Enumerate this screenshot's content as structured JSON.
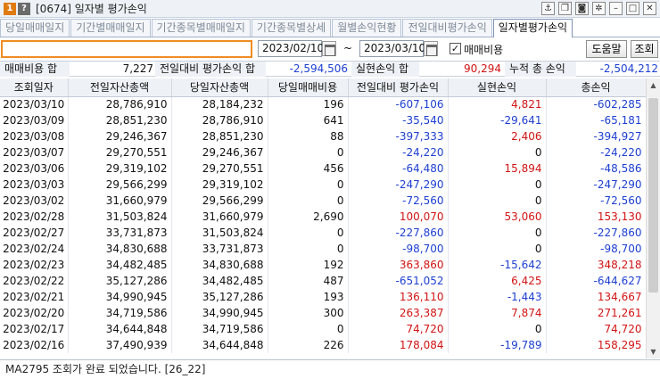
{
  "window": {
    "badge_number": "1",
    "badge_help": "?",
    "title": "[0674] 일자별 평가손익",
    "icons": [
      "link-icon",
      "copy-icon",
      "camera-icon",
      "gear-icon",
      "minimize-icon",
      "maximize-icon",
      "close-icon"
    ]
  },
  "tabs": [
    {
      "label": "당일매매일지"
    },
    {
      "label": "기간별매매일지"
    },
    {
      "label": "기간종목별매매일지"
    },
    {
      "label": "기간종목별상세"
    },
    {
      "label": "월별손익현황"
    },
    {
      "label": "전일대비평가손익"
    },
    {
      "label": "일자별평가손익"
    }
  ],
  "active_tab_index": 6,
  "toolbar": {
    "account_value": "",
    "start_date": "2023/02/10",
    "tilde": "~",
    "end_date": "2023/03/10",
    "fee_checkbox_checked": true,
    "fee_checkbox_label": "매매비용",
    "help_button": "도움말",
    "search_button": "조회"
  },
  "summary": {
    "fee_label": "매매비용 합",
    "fee_value": "7,227",
    "eval_label": "전일대비 평가손익 합",
    "eval_value": "-2,594,506",
    "realized_label": "실현손익 합",
    "realized_value": "90,294",
    "total_label": "누적 총 손익",
    "total_value": "-2,504,212"
  },
  "colors": {
    "negative": "#1d3fd1",
    "positive": "#d11414",
    "accent_border": "#f08c24"
  },
  "table": {
    "columns": [
      "조회일자",
      "전일자산총액",
      "당일자산총액",
      "당일매매비용",
      "전일대비 평가손익",
      "실현손익",
      "총손익"
    ],
    "rows": [
      [
        "2023/03/10",
        "28,786,910",
        "28,184,232",
        "196",
        "-607,106",
        "4,821",
        "-602,285"
      ],
      [
        "2023/03/09",
        "28,851,230",
        "28,786,910",
        "641",
        "-35,540",
        "-29,641",
        "-65,181"
      ],
      [
        "2023/03/08",
        "29,246,367",
        "28,851,230",
        "88",
        "-397,333",
        "2,406",
        "-394,927"
      ],
      [
        "2023/03/07",
        "29,270,551",
        "29,246,367",
        "0",
        "-24,220",
        "0",
        "-24,220"
      ],
      [
        "2023/03/06",
        "29,319,102",
        "29,270,551",
        "456",
        "-64,480",
        "15,894",
        "-48,586"
      ],
      [
        "2023/03/03",
        "29,566,299",
        "29,319,102",
        "0",
        "-247,290",
        "0",
        "-247,290"
      ],
      [
        "2023/03/02",
        "31,660,979",
        "29,566,299",
        "0",
        "-72,560",
        "0",
        "-72,560"
      ],
      [
        "2023/02/28",
        "31,503,824",
        "31,660,979",
        "2,690",
        "100,070",
        "53,060",
        "153,130"
      ],
      [
        "2023/02/27",
        "33,731,873",
        "31,503,824",
        "0",
        "-227,860",
        "0",
        "-227,860"
      ],
      [
        "2023/02/24",
        "34,830,688",
        "33,731,873",
        "0",
        "-98,700",
        "0",
        "-98,700"
      ],
      [
        "2023/02/23",
        "34,482,485",
        "34,830,688",
        "192",
        "363,860",
        "-15,642",
        "348,218"
      ],
      [
        "2023/02/22",
        "35,127,286",
        "34,482,485",
        "487",
        "-651,052",
        "6,425",
        "-644,627"
      ],
      [
        "2023/02/21",
        "34,990,945",
        "35,127,286",
        "193",
        "136,110",
        "-1,443",
        "134,667"
      ],
      [
        "2023/02/20",
        "34,719,586",
        "34,990,945",
        "300",
        "263,387",
        "7,874",
        "271,261"
      ],
      [
        "2023/02/17",
        "34,644,848",
        "34,719,586",
        "0",
        "74,720",
        "0",
        "74,720"
      ],
      [
        "2023/02/16",
        "37,490,939",
        "34,644,848",
        "226",
        "178,084",
        "-19,789",
        "158,295"
      ]
    ]
  },
  "status": {
    "message": "MA2795 조회가 완료 되었습니다. [26_22]"
  }
}
